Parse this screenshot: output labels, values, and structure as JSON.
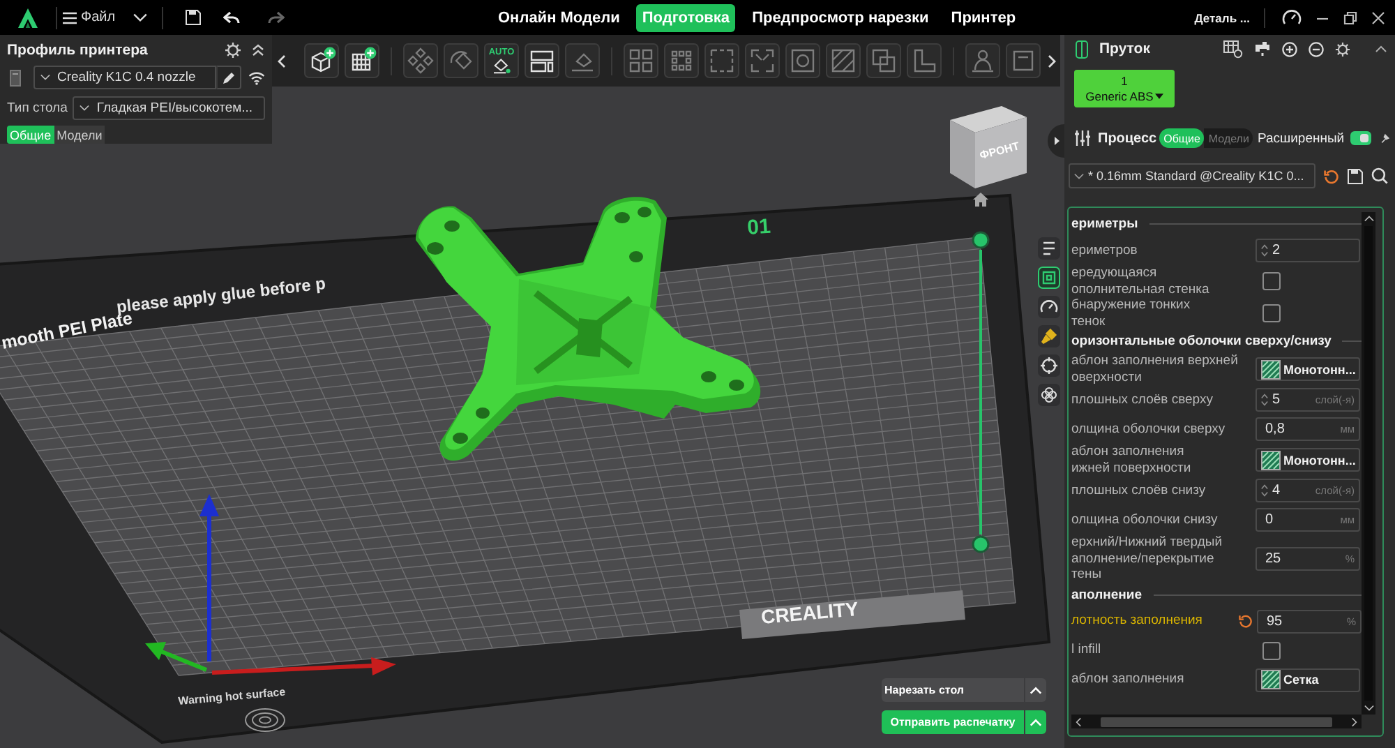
{
  "top_bar": {
    "menu": "Файл",
    "tabs": [
      {
        "label": "Онлайн Модели",
        "selected": false
      },
      {
        "label": "Подготовка",
        "selected": true
      },
      {
        "label": "Предпросмотр нарезки",
        "selected": false
      },
      {
        "label": "Принтер",
        "selected": false
      }
    ],
    "device": "Деталь ..."
  },
  "printer_panel": {
    "title": "Профиль принтера",
    "printer": "Creality K1C 0.4 nozzle",
    "bed_label": "Тип стола",
    "bed_type": "Гладкая PEI/высокотем...",
    "tabs": [
      {
        "label": "Общие",
        "selected": true
      },
      {
        "label": "Модели",
        "selected": false
      }
    ]
  },
  "toolbar": {
    "auto_label": "AUTO"
  },
  "viewport": {
    "plate_labels": [
      "please apply glue before p",
      "mooth PEI Plate",
      "01",
      "CREALITY",
      "Warning hot surface"
    ],
    "view_cube": "ФРОНТ"
  },
  "side_tools": [
    {
      "kind": "objects",
      "selected": false
    },
    {
      "kind": "slice",
      "selected": true
    },
    {
      "kind": "speed",
      "selected": false
    },
    {
      "kind": "paint",
      "selected": false
    },
    {
      "kind": "target",
      "selected": false
    },
    {
      "kind": "supports",
      "selected": false
    }
  ],
  "actions": [
    {
      "label": "Нарезать стол",
      "kind": "secondary"
    },
    {
      "label": "Отправить распечатку",
      "kind": "primary"
    }
  ],
  "filament": {
    "title": "Пруток",
    "slots": [
      {
        "number": "1",
        "name": "Generic ABS",
        "color": "#4fd13b"
      }
    ]
  },
  "process": {
    "title": "Процесс",
    "tabs": [
      {
        "label": "Общие",
        "selected": true
      },
      {
        "label": "Модели",
        "selected": false
      }
    ],
    "advanced_label": "Расширенный",
    "advanced_on": true,
    "preset": "* 0.16mm Standard @Creality K1C 0..."
  },
  "settings": {
    "rows": [
      {
        "kind": "section",
        "label": "ериметры"
      },
      {
        "kind": "spinner",
        "label": "ериметров",
        "value": "2",
        "modified": false
      },
      {
        "kind": "checkbox",
        "label": "ередующаяся\nополнительная стенка",
        "checked": false,
        "modified": false
      },
      {
        "kind": "checkbox",
        "label": "бнаружение тонких\nтенок",
        "checked": false,
        "modified": false
      },
      {
        "kind": "section",
        "label": "оризонтальные оболочки сверху/снизу"
      },
      {
        "kind": "pattern",
        "label": "аблон заполнения верхней\nоверхности",
        "value": "Монотонн...",
        "modified": false
      },
      {
        "kind": "spinner",
        "label": "плошных слоёв сверху",
        "value": "5",
        "unit": "слой(-я)",
        "modified": false
      },
      {
        "kind": "text",
        "label": "олщина оболочки сверху",
        "value": "0,8",
        "unit": "мм",
        "modified": false
      },
      {
        "kind": "pattern",
        "label": "аблон заполнения\nижней поверхности",
        "value": "Монотонн...",
        "modified": false
      },
      {
        "kind": "spinner",
        "label": "плошных слоёв снизу",
        "value": "4",
        "unit": "слой(-я)",
        "modified": false
      },
      {
        "kind": "text",
        "label": "олщина оболочки снизу",
        "value": "0",
        "unit": "мм",
        "modified": false
      },
      {
        "kind": "text",
        "label": "ерхний/Нижний твердый\nаполнение/перекрытие\nтены",
        "value": "25",
        "unit": "%",
        "modified": false
      },
      {
        "kind": "section",
        "label": "аполнение"
      },
      {
        "kind": "text",
        "label": "лотность заполнения",
        "value": "95",
        "unit": "%",
        "modified": true
      },
      {
        "kind": "checkbox",
        "label": "l infill",
        "checked": false,
        "modified": false
      },
      {
        "kind": "pattern",
        "label": "аблон заполнения",
        "value": "Сетка",
        "modified": false
      }
    ]
  }
}
